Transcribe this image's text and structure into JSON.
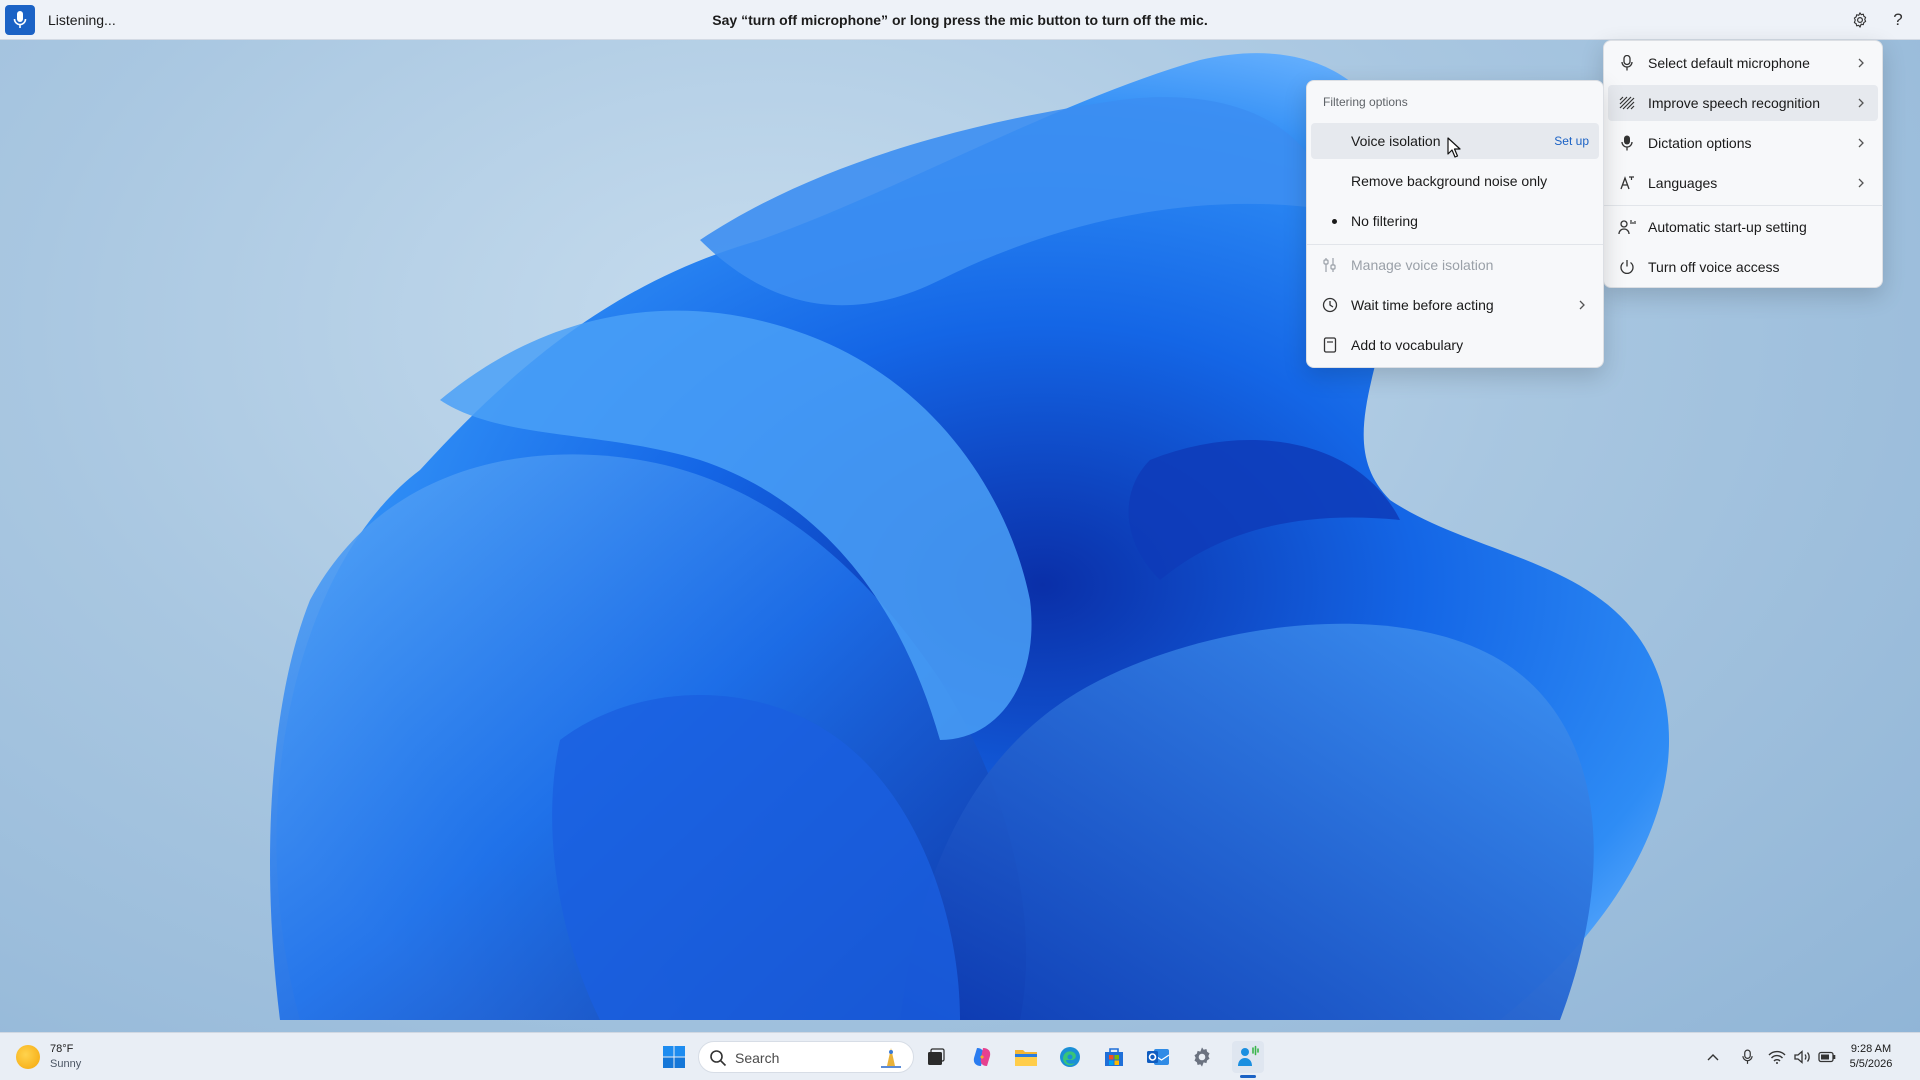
{
  "voice_bar": {
    "status": "Listening...",
    "hint": "Say “turn off microphone” or long press the mic button to turn off the mic.",
    "mic_icon": "microphone-icon",
    "settings_icon": "gear-icon",
    "help_icon": "help-icon",
    "help_glyph": "?"
  },
  "main_menu": {
    "items": [
      {
        "label": "Select default microphone",
        "icon": "microphone-icon",
        "has_submenu": true
      },
      {
        "label": "Improve speech recognition",
        "icon": "speech-waves-icon",
        "has_submenu": true,
        "highlighted": true
      },
      {
        "label": "Dictation options",
        "icon": "dictation-mic-icon",
        "has_submenu": true
      },
      {
        "label": "Languages",
        "icon": "language-icon",
        "has_submenu": true
      },
      {
        "label": "Automatic start-up setting",
        "icon": "person-startup-icon",
        "has_submenu": false
      },
      {
        "label": "Turn off voice access",
        "icon": "power-icon",
        "has_submenu": false
      }
    ]
  },
  "sub_menu": {
    "header": "Filtering options",
    "voice_isolation": {
      "label": "Voice isolation",
      "action": "Set up"
    },
    "remove_noise": {
      "label": "Remove background noise only"
    },
    "no_filtering": {
      "label": "No filtering",
      "selected": true
    },
    "manage_isolation": {
      "label": "Manage voice isolation",
      "disabled": true,
      "icon": "sliders-icon"
    },
    "wait_time": {
      "label": "Wait time before acting",
      "icon": "clock-icon",
      "has_submenu": true
    },
    "vocabulary": {
      "label": "Add to vocabulary",
      "icon": "notebook-icon"
    }
  },
  "taskbar": {
    "weather": {
      "temp": "78°F",
      "condition": "Sunny"
    },
    "search_placeholder": "Search",
    "clock": {
      "time": "9:28 AM",
      "date": "5/5/2026"
    },
    "pinned": [
      "start-icon",
      "task-view-icon",
      "copilot-icon",
      "file-explorer-icon",
      "edge-icon",
      "store-icon",
      "outlook-icon",
      "settings-icon",
      "voice-access-icon"
    ],
    "tray": [
      "chevron-up-icon",
      "microphone-icon",
      "wifi-icon",
      "volume-icon",
      "battery-icon"
    ]
  },
  "colors": {
    "accent": "#1b62c5",
    "menu_bg": "#f7f8fa",
    "bar_bg": "#eef2f8"
  }
}
